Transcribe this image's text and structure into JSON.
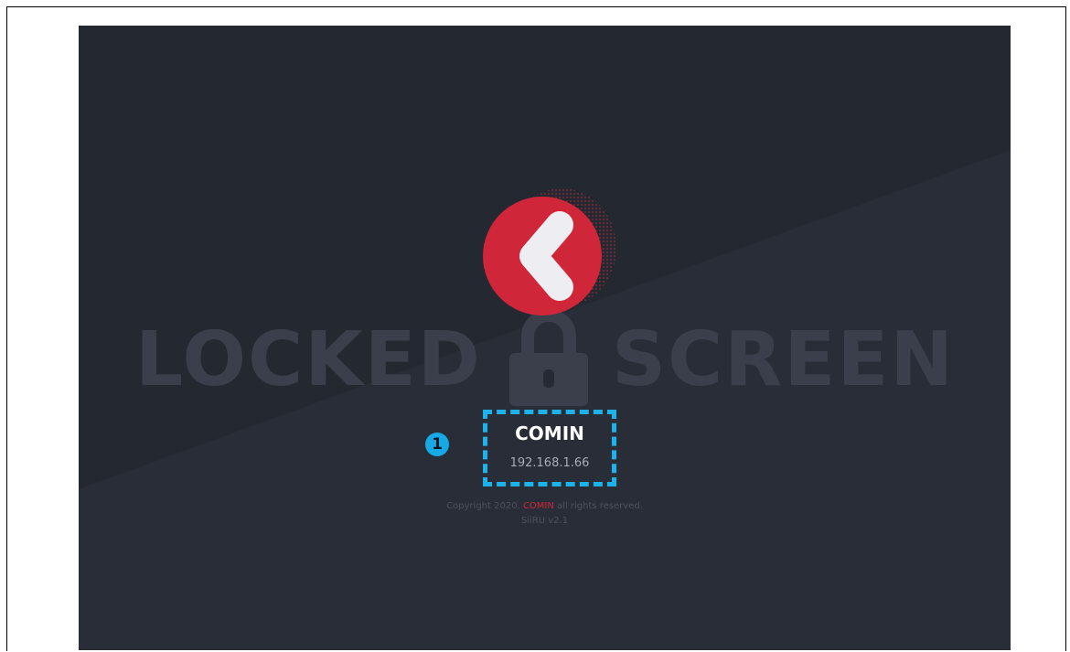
{
  "watermark": {
    "left": "LOCKED",
    "right": "SCREEN"
  },
  "device": {
    "name": "COMIN",
    "ip": "192.168.1.66"
  },
  "callout": {
    "number": "1"
  },
  "footer": {
    "copyright_prefix": "Copyright 2020. ",
    "brand": "COMIN",
    "copyright_suffix": " all rights reserved.",
    "version": "SiiRU v2.1"
  },
  "icons": {
    "logo": "chevron-left-logo-icon",
    "lock": "lock-icon"
  },
  "colors": {
    "background": "#262a34",
    "brand_red": "#d0263a",
    "callout_blue": "#1db3ea",
    "watermark": "#3a3f4b"
  }
}
